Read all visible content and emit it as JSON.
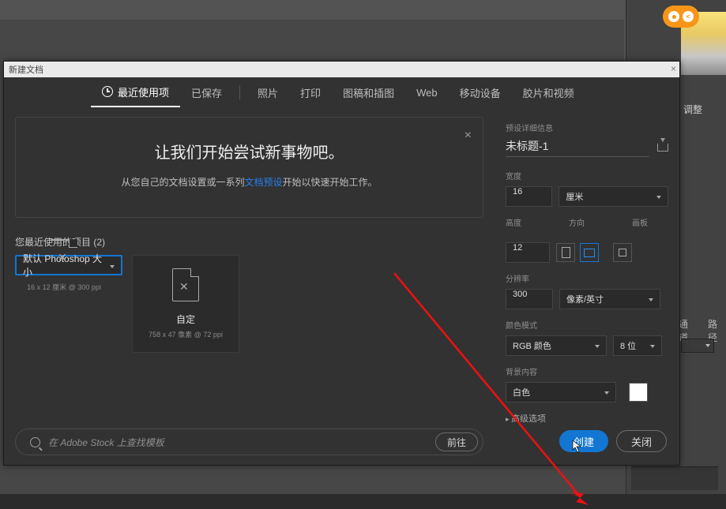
{
  "dialog": {
    "title": "新建文档",
    "tabs": {
      "recent": "最近使用项",
      "saved": "已保存",
      "photo": "照片",
      "print": "打印",
      "art": "图稿和插图",
      "web": "Web",
      "mobile": "移动设备",
      "film": "胶片和视频"
    },
    "intro": {
      "headline": "让我们开始尝试新事物吧。",
      "pre": "从您自己的文档设置或一系列",
      "link": "文档预设",
      "post": "开始以快速开始工作。"
    },
    "recent_label": "您最近使用的项目 (2)",
    "cards": [
      {
        "title": "默认 Photoshop 大小",
        "meta": "16 x 12 厘米 @ 300 ppi"
      },
      {
        "title": "自定",
        "meta": "758 x 47 像素 @ 72 ppi"
      }
    ],
    "search_placeholder": "在 Adobe Stock 上查找模板",
    "go_btn": "前往"
  },
  "preset": {
    "details_lbl": "预设详细信息",
    "name": "未标题-1",
    "width_lbl": "宽度",
    "width_val": "16",
    "unit": "厘米",
    "height_lbl": "高度",
    "height_val": "12",
    "orient_lbl": "方向",
    "artboard_lbl": "画板",
    "res_lbl": "分辨率",
    "res_val": "300",
    "res_unit": "像素/英寸",
    "color_lbl": "颜色模式",
    "color_mode": "RGB 颜色",
    "bit_depth": "8 位",
    "bg_lbl": "背景内容",
    "bg_val": "白色",
    "adv": "高级选项",
    "create": "创建",
    "close": "关闭"
  },
  "bg_panels": {
    "adjust": "调整",
    "channels": "通道",
    "paths": "路径"
  }
}
